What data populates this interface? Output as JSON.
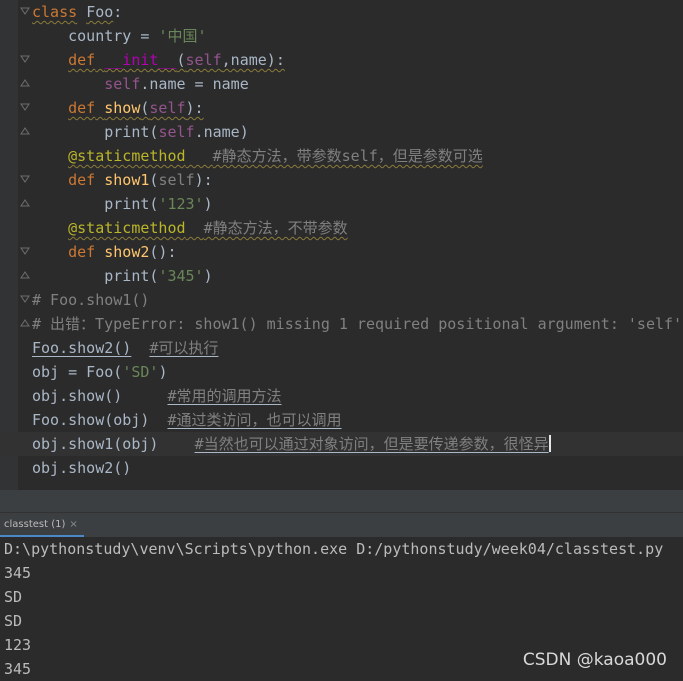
{
  "code": {
    "l1_kw": "class",
    "l1_name": "Foo",
    "l1_colon": ":",
    "l2_text": "    country = ",
    "l2_str": "'中国'",
    "l3_indent": "    ",
    "l3_def": "def",
    "l3_sp": " ",
    "l3_init": "__init__",
    "l3_open": "(",
    "l3_self": "self",
    "l3_rest": ",name):",
    "l4_indent": "        ",
    "l4_self": "self",
    "l4_rest": ".name = name",
    "l5_indent": "    ",
    "l5_def": "def",
    "l5_sp": " ",
    "l5_name": "show",
    "l5_open": "(",
    "l5_self": "self",
    "l5_close": "):",
    "l6_indent": "        ",
    "l6_print": "print(",
    "l6_self": "self",
    "l6_rest": ".name)",
    "l7_indent": "    ",
    "l7_dec": "@staticmethod",
    "l7_gap": "   ",
    "l7_comment": "#静态方法，带参数self，但是参数可选",
    "l8_indent": "    ",
    "l8_def": "def",
    "l8_sp": " ",
    "l8_name": "show1",
    "l8_open": "(",
    "l8_self": "self",
    "l8_close": "):",
    "l9_indent": "        ",
    "l9_print": "print(",
    "l9_str": "'123'",
    "l9_close": ")",
    "l10_indent": "    ",
    "l10_dec": "@staticmethod",
    "l10_gap": "  ",
    "l10_comment": "#静态方法，不带参数",
    "l11_indent": "    ",
    "l11_def": "def",
    "l11_sp": " ",
    "l11_name": "show2",
    "l11_rest": "():",
    "l12_indent": "        ",
    "l12_print": "print(",
    "l12_str": "'345'",
    "l12_close": ")",
    "l13_comment": "# Foo.show1()",
    "l14_comment": "# 出错：TypeError: show1() missing 1 required positional argument: 'self'",
    "l15_call": "Foo.show2()",
    "l15_gap": "  ",
    "l15_comment": "#可以执行",
    "l16_text": "obj = Foo(",
    "l16_str": "'SD'",
    "l16_close": ")",
    "l17_code": "obj.show()",
    "l17_gap": "     ",
    "l17_comment": "#常用的调用方法",
    "l18_code": "Foo.show(obj)",
    "l18_gap": "  ",
    "l18_comment": "#通过类访问，也可以调用",
    "l19_code": "obj.show1(obj)",
    "l19_gap": "    ",
    "l19_comment": "#当然也可以通过对象访问，但是要传递参数，很怪异",
    "l20_code": "obj.show2()"
  },
  "run_tab": {
    "label": "classtest (1)",
    "close": "×"
  },
  "console": {
    "lines": [
      "D:\\pythonstudy\\venv\\Scripts\\python.exe D:/pythonstudy/week04/classtest.py",
      "345",
      "SD",
      "SD",
      "123",
      "345"
    ]
  },
  "watermark": "CSDN @kaoa000",
  "colors": {
    "editor_bg": "#2b2b2b",
    "keyword": "#cc7832",
    "function": "#ffc66d",
    "string": "#6a8759",
    "comment": "#808080",
    "decorator": "#bbb529",
    "self": "#94558d"
  },
  "icons": {
    "fold_marker": "fold-arrow-icon"
  }
}
